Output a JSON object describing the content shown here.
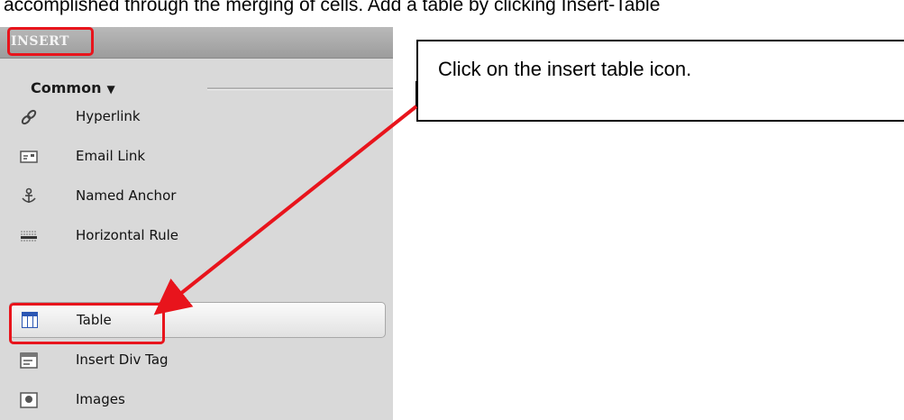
{
  "document": {
    "text": "accomplished through the merging of cells.  Add a table by clicking Insert-Table"
  },
  "panel": {
    "title": "INSERT",
    "category": "Common",
    "items": [
      {
        "label": "Hyperlink",
        "icon": "hyperlink-icon"
      },
      {
        "label": "Email Link",
        "icon": "email-link-icon"
      },
      {
        "label": "Named Anchor",
        "icon": "named-anchor-icon"
      },
      {
        "label": "Horizontal Rule",
        "icon": "horizontal-rule-icon"
      },
      {
        "label": "Table",
        "icon": "table-icon",
        "selected": true
      },
      {
        "label": "Insert Div Tag",
        "icon": "insert-div-tag-icon"
      },
      {
        "label": "Images",
        "icon": "images-icon"
      }
    ]
  },
  "callout": {
    "text": "Click on the insert table icon."
  },
  "colors": {
    "highlight": "#e8141c",
    "panel_background": "#d9d9d9"
  }
}
